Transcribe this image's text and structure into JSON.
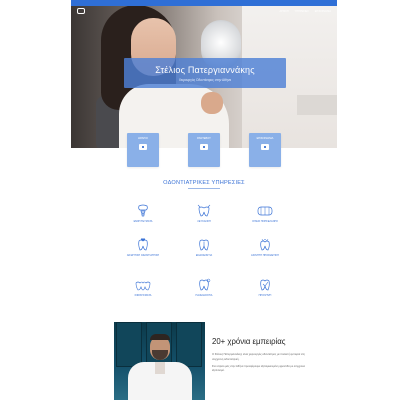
{
  "nav": {
    "links": [
      "ΑΡΧΙΚΗ",
      "ΥΠΗΡΕΣΙΕΣ",
      "ΕΠΙΚΟΙΝΩΝΙΑ"
    ]
  },
  "hero": {
    "title": "Στέλιος Πατεργιαννάκης",
    "subtitle": "Χειρουργός Οδοντίατρος στην Αθήνα"
  },
  "cards": [
    {
      "label": "ΩΡΑΡΙΟ",
      "icon": "calendar-icon"
    },
    {
      "label": "ΡΑΝΤΕΒΟΥ",
      "icon": "calendar-icon"
    },
    {
      "label": "ΕΠΙΚΟΙΝΩΝΙΑ",
      "icon": "mail-icon"
    }
  ],
  "services": {
    "title": "ΟΔΟΝΤΙΑΤΡΙΚΕΣ ΥΠΗΡΕΣΙΕΣ",
    "items": [
      {
        "label": "ΕΜΦΥΤΕΥΜΑΤΑ",
        "icon": "implant-icon"
      },
      {
        "label": "ΛΕΥΚΑΝΣΗ",
        "icon": "whitening-icon"
      },
      {
        "label": "ΟΨΕΙΣ ΠΟΡΣΕΛΑΝΗΣ",
        "icon": "veneer-icon"
      },
      {
        "label": "ΑΙΣΘΗΤΙΚΗ ΟΔΟΝΤΙΑΤΡΙΚΗ",
        "icon": "tooth-icon"
      },
      {
        "label": "ΕΝΔΟΔΟΝΤΙΑ",
        "icon": "root-canal-icon"
      },
      {
        "label": "ΑΚΙΝΗΤΗ ΠΡΟΣΘΕΤΙΚΗ",
        "icon": "crown-icon"
      },
      {
        "label": "ΣΦΡΑΓΙΣΜΑΤΑ",
        "icon": "filling-icon"
      },
      {
        "label": "ΠΑΙΔΟΔΟΝΤΙΑ",
        "icon": "child-tooth-icon"
      },
      {
        "label": "ΠΡΟΛΗΨΗ",
        "icon": "prevention-icon"
      }
    ]
  },
  "about": {
    "title": "20+ χρόνια εμπειρίας",
    "paragraphs": [
      "Ο Στέλιος Πατεργιαννάκης είναι χειρουργός οδοντίατρος με πολυετή εμπειρία στη σύγχρονη οδοντιατρική.",
      "Στο ιατρείο μας στην Αθήνα προσφέρουμε εξατομικευμένη φροντίδα με σύγχρονο εξοπλισμό."
    ]
  },
  "colors": {
    "accent": "#3b73d6",
    "banner": "#4e80d6",
    "card": "#8ab0e8"
  }
}
